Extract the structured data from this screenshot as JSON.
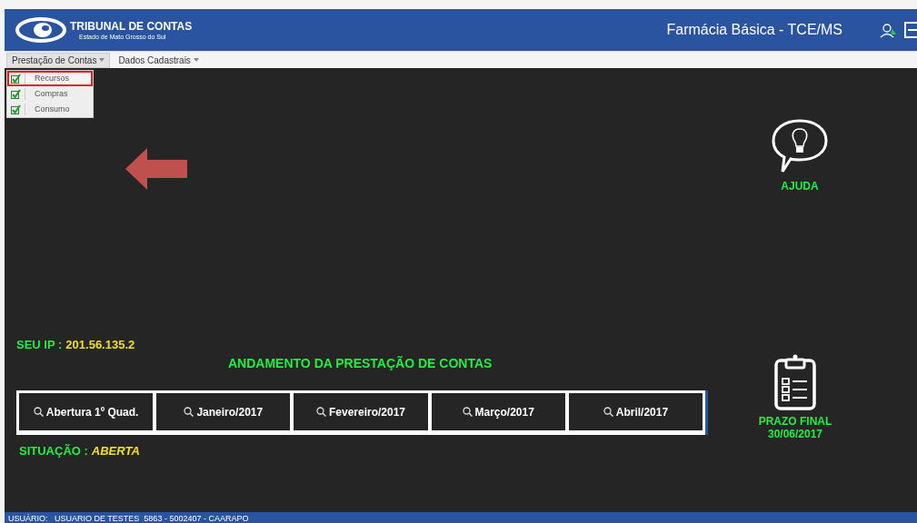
{
  "header": {
    "logo_title": "TRIBUNAL DE CONTAS",
    "logo_subtitle": "Estado de Mato Grosso do Sul",
    "app_title": "Farmácia Básica - TCE/MS"
  },
  "menu": [
    {
      "label": "Prestação de Contas",
      "expanded": true,
      "items": [
        {
          "label": "Recursos",
          "selected": true
        },
        {
          "label": "Compras",
          "selected": false
        },
        {
          "label": "Consumo",
          "selected": false
        }
      ]
    },
    {
      "label": "Dados Cadastrais",
      "expanded": false
    }
  ],
  "help": {
    "label": "AJUDA"
  },
  "ip": {
    "label": "SEU IP :",
    "value": "201.56.135.2"
  },
  "progress": {
    "title": "ANDAMENTO DA PRESTAÇÃO DE CONTAS",
    "steps": [
      "Abertura 1º Quad.",
      "Janeiro/2017",
      "Fevereiro/2017",
      "Março/2017",
      "Abril/2017"
    ]
  },
  "situation": {
    "label": "SITUAÇÃO :",
    "value": "ABERTA"
  },
  "deadline": {
    "label": "PRAZO FINAL",
    "date": "30/06/2017"
  },
  "status_bar": {
    "label": "USUÁRIO:",
    "value": "USUARIO DE TESTES  5863 - 5002407 - CAARAPO"
  }
}
